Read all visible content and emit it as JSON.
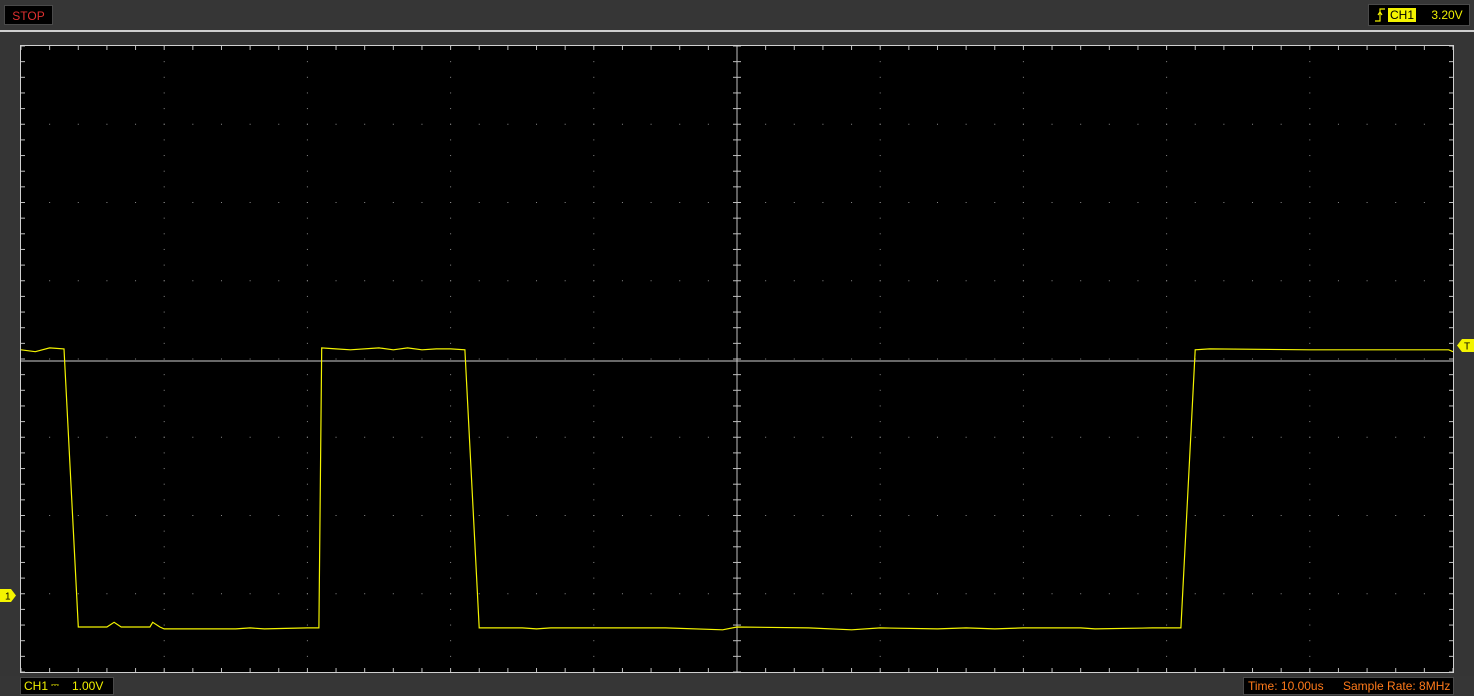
{
  "status": {
    "label": "STOP",
    "color": "#e03030"
  },
  "trigger": {
    "edge_icon": "rising-edge-icon",
    "channel": "CH1",
    "level": "3.20V"
  },
  "channel_scale": {
    "name": "CH1",
    "coupling": "⎓",
    "volts_per_div": "1.00V"
  },
  "timebase": {
    "time": "Time: 10.00us",
    "sample_rate": "Sample Rate: 8MHz"
  },
  "markers": {
    "ground": "1",
    "trigger": "T"
  },
  "colors": {
    "trace": "#f4f400",
    "grid": "#8a8a8a",
    "accent_orange": "#ff7a1a"
  },
  "chart_data": {
    "type": "line",
    "x_divisions": 10,
    "y_divisions": 8,
    "series": [
      {
        "x": [
          0.0,
          0.1,
          0.3,
          0.4,
          1.0,
          1.2,
          1.5,
          1.8,
          2.0,
          2.4,
          2.5,
          2.6,
          2.8,
          3.0,
          3.2,
          3.6,
          3.7,
          3.9,
          4.2,
          4.5,
          5.0,
          5.5,
          6.0,
          6.3,
          6.45,
          6.6,
          6.8,
          7.1,
          7.2,
          7.4,
          8.0,
          9.0,
          10.0
        ],
        "y": [
          0.12,
          0.1,
          0.14,
          0.13,
          0.12,
          0.11,
          0.11,
          0.1,
          0.13,
          0.12,
          0.14,
          0.12,
          0.13,
          0.12,
          0.12,
          0.13,
          0.12,
          0.12,
          0.12,
          0.12,
          0.12,
          0.11,
          0.13,
          0.12,
          0.12,
          0.12,
          0.12,
          0.12,
          0.13,
          0.12,
          0.12,
          0.12,
          0.12
        ],
        "segments_low": [
          [
            0.35,
            2.0
          ],
          [
            3.0,
            8.0
          ]
        ]
      }
    ],
    "trace_points": [
      [
        0.0,
        0.12
      ],
      [
        0.1,
        0.1
      ],
      [
        0.2,
        0.14
      ],
      [
        0.3,
        0.13
      ],
      [
        0.3,
        0.13
      ],
      [
        0.4,
        -2.85
      ],
      [
        0.6,
        -2.85
      ],
      [
        0.6,
        -2.85
      ],
      [
        0.65,
        -2.8
      ],
      [
        0.7,
        -2.85
      ],
      [
        0.8,
        -2.85
      ],
      [
        0.9,
        -2.85
      ],
      [
        0.92,
        -2.8
      ],
      [
        0.97,
        -2.85
      ],
      [
        1.0,
        -2.87
      ],
      [
        1.5,
        -2.87
      ],
      [
        1.6,
        -2.86
      ],
      [
        1.7,
        -2.87
      ],
      [
        2.0,
        -2.86
      ],
      [
        2.08,
        -2.86
      ],
      [
        2.1,
        0.14
      ],
      [
        2.2,
        0.13
      ],
      [
        2.3,
        0.12
      ],
      [
        2.5,
        0.14
      ],
      [
        2.6,
        0.12
      ],
      [
        2.7,
        0.14
      ],
      [
        2.8,
        0.12
      ],
      [
        2.9,
        0.13
      ],
      [
        3.0,
        0.13
      ],
      [
        3.1,
        0.12
      ],
      [
        3.2,
        -2.86
      ],
      [
        3.5,
        -2.86
      ],
      [
        3.6,
        -2.87
      ],
      [
        3.7,
        -2.86
      ],
      [
        4.5,
        -2.86
      ],
      [
        4.9,
        -2.88
      ],
      [
        5.0,
        -2.85
      ],
      [
        5.5,
        -2.86
      ],
      [
        5.8,
        -2.88
      ],
      [
        6.0,
        -2.86
      ],
      [
        6.4,
        -2.87
      ],
      [
        6.6,
        -2.86
      ],
      [
        6.8,
        -2.87
      ],
      [
        7.0,
        -2.86
      ],
      [
        7.4,
        -2.86
      ],
      [
        7.5,
        -2.87
      ],
      [
        7.9,
        -2.86
      ],
      [
        8.0,
        -2.86
      ],
      [
        8.1,
        -2.86
      ],
      [
        8.2,
        0.12
      ],
      [
        8.3,
        0.13
      ],
      [
        9.0,
        0.12
      ],
      [
        9.97,
        0.12
      ],
      [
        10.0,
        0.1
      ]
    ]
  }
}
